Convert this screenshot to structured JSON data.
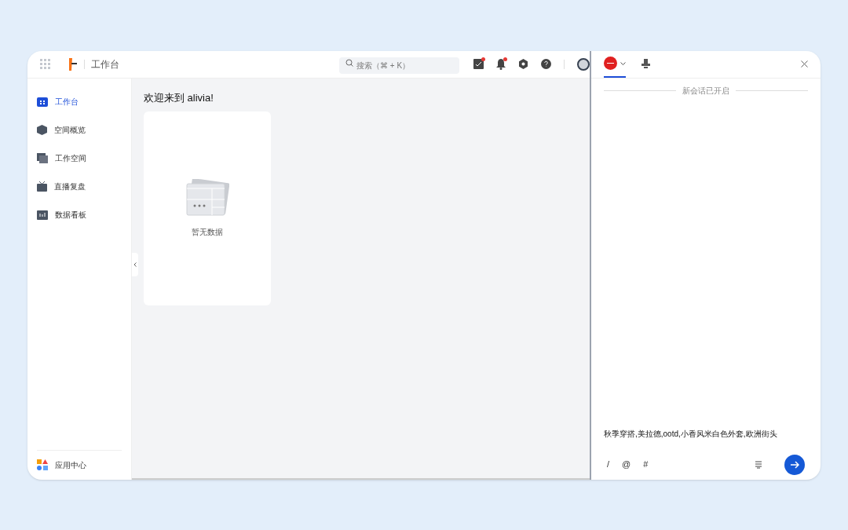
{
  "header": {
    "title": "工作台",
    "search": {
      "placeholder": "搜索（⌘ + K）"
    },
    "badges": {
      "tasks": true,
      "notifications": true
    }
  },
  "sidebar": {
    "items": [
      {
        "label": "工作台",
        "kind": "workbench",
        "selected": true
      },
      {
        "label": "空间概览",
        "kind": "cube",
        "selected": false
      },
      {
        "label": "工作空间",
        "kind": "stack",
        "selected": false
      },
      {
        "label": "直播复盘",
        "kind": "tv",
        "selected": false
      },
      {
        "label": "数据看板",
        "kind": "board",
        "selected": false
      }
    ],
    "footer": "应用中心"
  },
  "main": {
    "heading": "欢迎来到 alivia!",
    "empty_text": "暂无数据"
  },
  "chat": {
    "tabs": [
      {
        "kind": "logo",
        "selected": true
      },
      {
        "kind": "stamp",
        "selected": false
      }
    ],
    "divider_text": "新会话已开启",
    "input": {
      "value": "秋季穿搭,美拉德,ootd,小香风米白色外套,欧洲街头"
    },
    "tools": [
      "/",
      "@",
      "#"
    ]
  }
}
